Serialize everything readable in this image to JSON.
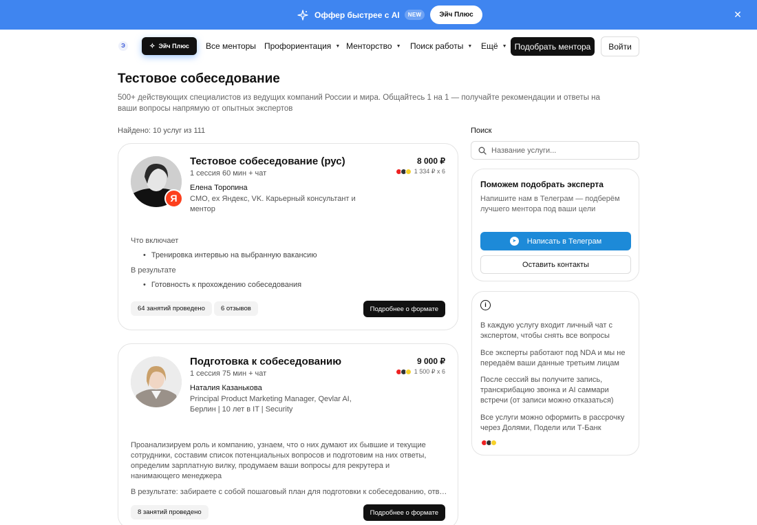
{
  "banner": {
    "text": "Оффер быстрее с AI",
    "badge": "NEW",
    "button": "Эйч Плюс"
  },
  "header": {
    "logo": "Э",
    "plus_button": "Эйч Плюс",
    "nav": [
      "Все менторы",
      "Профориентация",
      "Менторство",
      "Поиск работы",
      "Ещё"
    ],
    "pick_mentor": "Подобрать ментора",
    "login": "Войти"
  },
  "page": {
    "title": "Тестовое собеседование",
    "subtitle": "500+ действующих специалистов из ведущих компаний России и мира. Общайтесь 1 на 1 — получайте рекомендации и ответы на ваши вопросы напрямую от опытных экспертов",
    "found": "Найдено: 10 услуг из 111"
  },
  "cards": [
    {
      "title": "Тестовое собеседование (рус)",
      "meta": "1 сессия 60 мин + чат",
      "mentor_name": "Елена Торопина",
      "mentor_desc": "CMO, ex Яндекс, VK. Карьерный консультант и ментор",
      "company_badge": "Я",
      "price": "8 000 ₽",
      "installment": "1 334 ₽ x 6",
      "includes_label": "Что включает",
      "includes": "Тренировка интервью на выбранную вакансию",
      "result_label": "В результате",
      "result": "Готовность к прохождению собеседования",
      "tag_sessions": "64 занятий проведено",
      "tag_reviews": "6 отзывов",
      "more": "Подробнее о формате"
    },
    {
      "title": "Подготовка к собеседованию",
      "meta": "1 сессия 75 мин + чат",
      "mentor_name": "Наталия Казанькова",
      "mentor_desc": "Principal Product Marketing Manager, Qevlar AI, Берлин | 10 лет в IT | Security",
      "price": "9 000 ₽",
      "installment": "1 500 ₽ x 6",
      "body": "Проанализируем роль и компанию, узнаем, что о них думают их бывшие и текущие сотрудники, составим список потенциальных вопросов и подготовим на них ответы, определим зарплатную вилку, продумаем ваши вопросы для рекрутера и нанимающего менеджера",
      "result": "В результате: забираете с собой пошаговый план для подготовки к собеседованию, ответ...",
      "tag_sessions": "8 занятий проведено",
      "more": "Подробнее о формате"
    }
  ],
  "sidebar": {
    "search_label": "Поиск",
    "search_placeholder": "Название услуги...",
    "help_title": "Поможем подобрать эксперта",
    "help_text": "Напишите нам в Телеграм — подберём лучшего ментора под ваши цели",
    "telegram_button": "Написать в Телеграм",
    "contacts_button": "Оставить контакты",
    "info": [
      "В каждую услугу входит личный чат с экспертом, чтобы снять все вопросы",
      "Все эксперты работают под NDA и мы не передаём ваши данные третьим лицам",
      "После сессий вы получите запись, транскрибацию звонка и AI саммари встречи (от записи можно отказаться)",
      "Все услуги можно оформить в рассрочку через Долями, Подели или Т-Банк"
    ]
  },
  "colors": {
    "banner": "#3f85f0",
    "primary_button": "#111111",
    "telegram": "#1d8ad8",
    "yandex": "#fc3f1d"
  }
}
